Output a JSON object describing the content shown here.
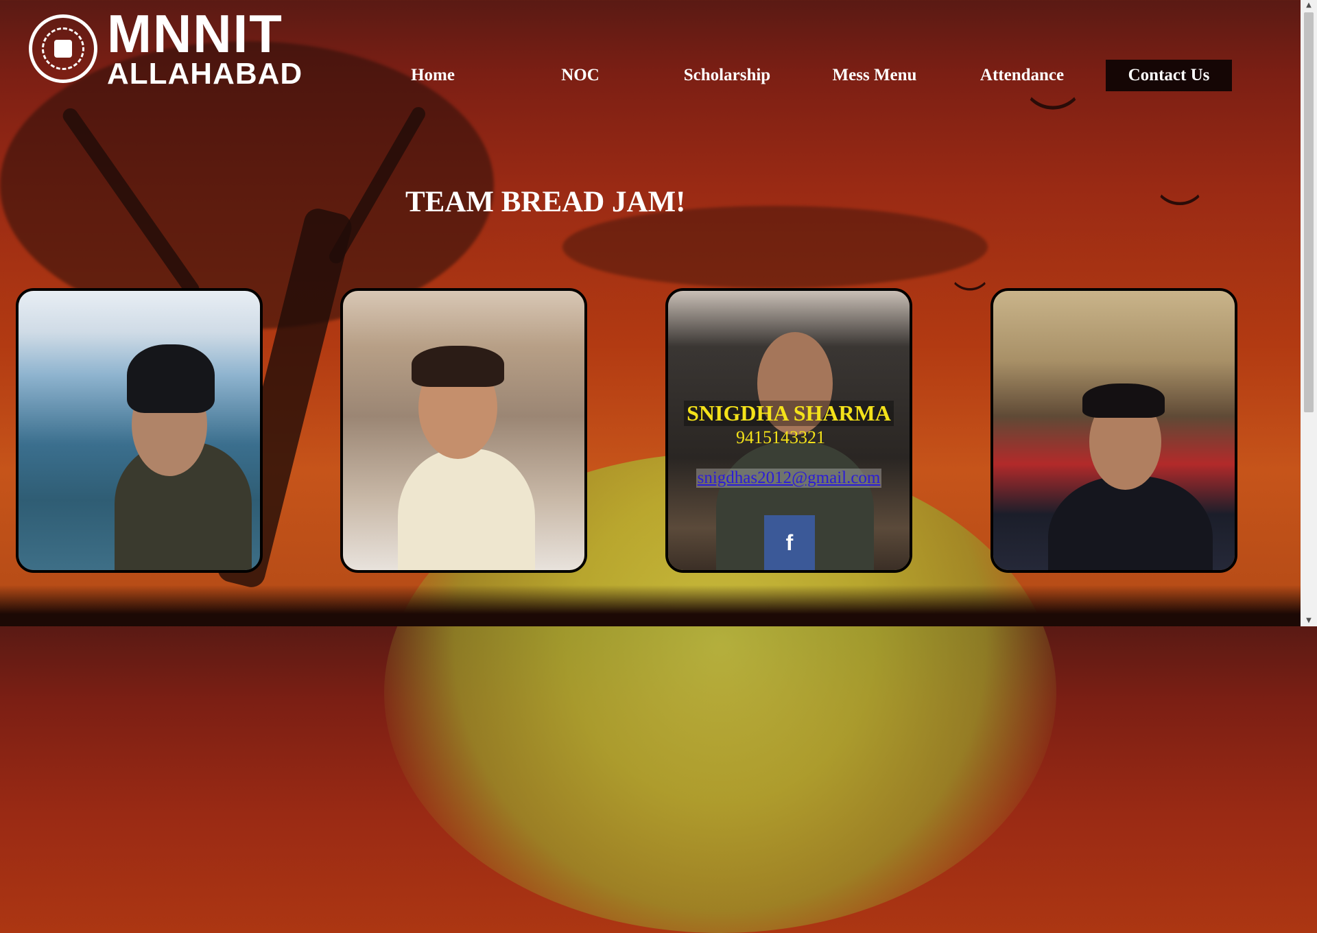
{
  "brand": {
    "logo_main": "MNNIT",
    "logo_sub": "ALLAHABAD"
  },
  "nav": {
    "items": [
      {
        "label": "Home"
      },
      {
        "label": "NOC"
      },
      {
        "label": "Scholarship"
      },
      {
        "label": "Mess Menu"
      },
      {
        "label": "Attendance"
      },
      {
        "label": "Contact Us"
      }
    ],
    "active": "Contact Us"
  },
  "page": {
    "title": "TEAM BREAD JAM!"
  },
  "team": {
    "featured": {
      "name": "SNIGDHA SHARMA",
      "phone": "9415143321",
      "email": "snigdhas2012@gmail.com",
      "social_icon": "facebook-icon",
      "social_glyph": "f"
    }
  },
  "colors": {
    "active_nav_bg": "#150605",
    "name_text": "#f4e21a",
    "facebook_blue": "#3b5998"
  }
}
